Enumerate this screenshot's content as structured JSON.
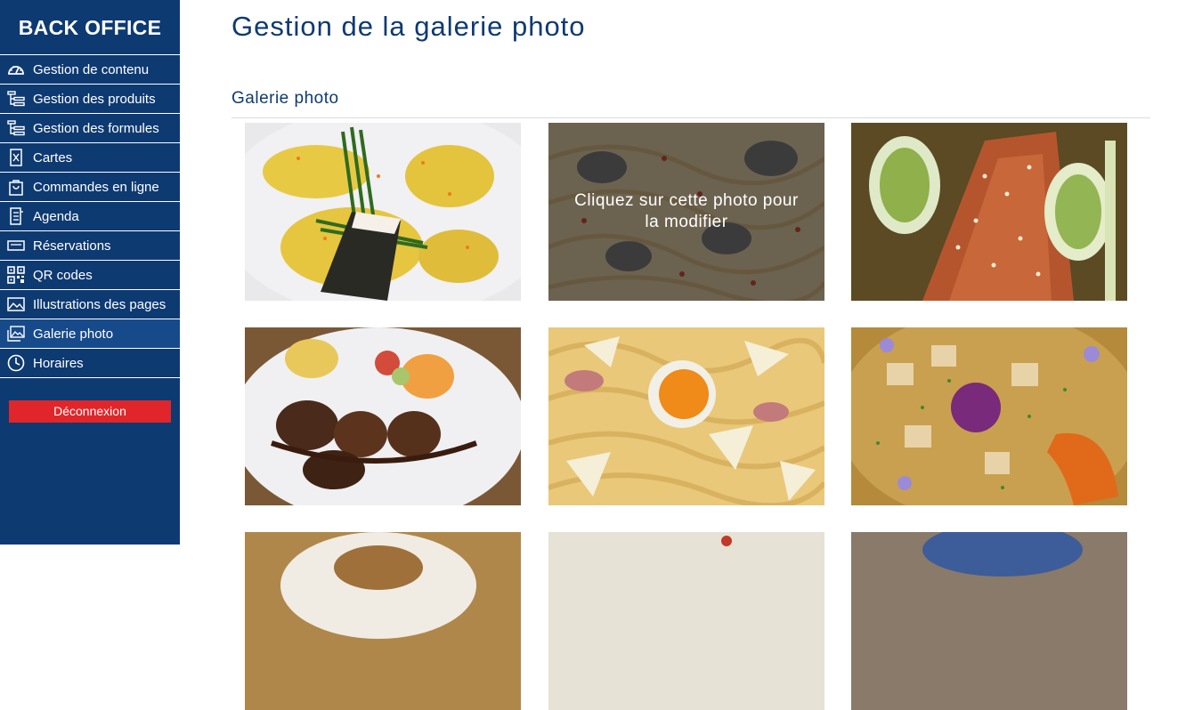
{
  "sidebar": {
    "brand": "BACK OFFICE",
    "items": [
      {
        "label": "Gestion de contenu",
        "icon": "dashboard-icon"
      },
      {
        "label": "Gestion des produits",
        "icon": "tree-list-icon"
      },
      {
        "label": "Gestion des formules",
        "icon": "tree-list-icon"
      },
      {
        "label": "Cartes",
        "icon": "menu-card-icon"
      },
      {
        "label": "Commandes en ligne",
        "icon": "shopping-bag-icon"
      },
      {
        "label": "Agenda",
        "icon": "agenda-icon"
      },
      {
        "label": "Réservations",
        "icon": "ticket-icon"
      },
      {
        "label": "QR codes",
        "icon": "qr-code-icon"
      },
      {
        "label": "Illustrations des pages",
        "icon": "image-icon"
      },
      {
        "label": "Galerie photo",
        "icon": "gallery-icon"
      },
      {
        "label": "Horaires",
        "icon": "clock-icon"
      }
    ],
    "active_item": "Galerie photo",
    "logout_label": "Déconnexion"
  },
  "main": {
    "title": "Gestion de la galerie photo",
    "section_title": "Galerie photo",
    "hover_caption": "Cliquez sur cette photo pour la modifier"
  },
  "colors": {
    "sidebar_bg": "#0e3a72",
    "title": "#0e3a72",
    "logout": "#e0262a"
  }
}
